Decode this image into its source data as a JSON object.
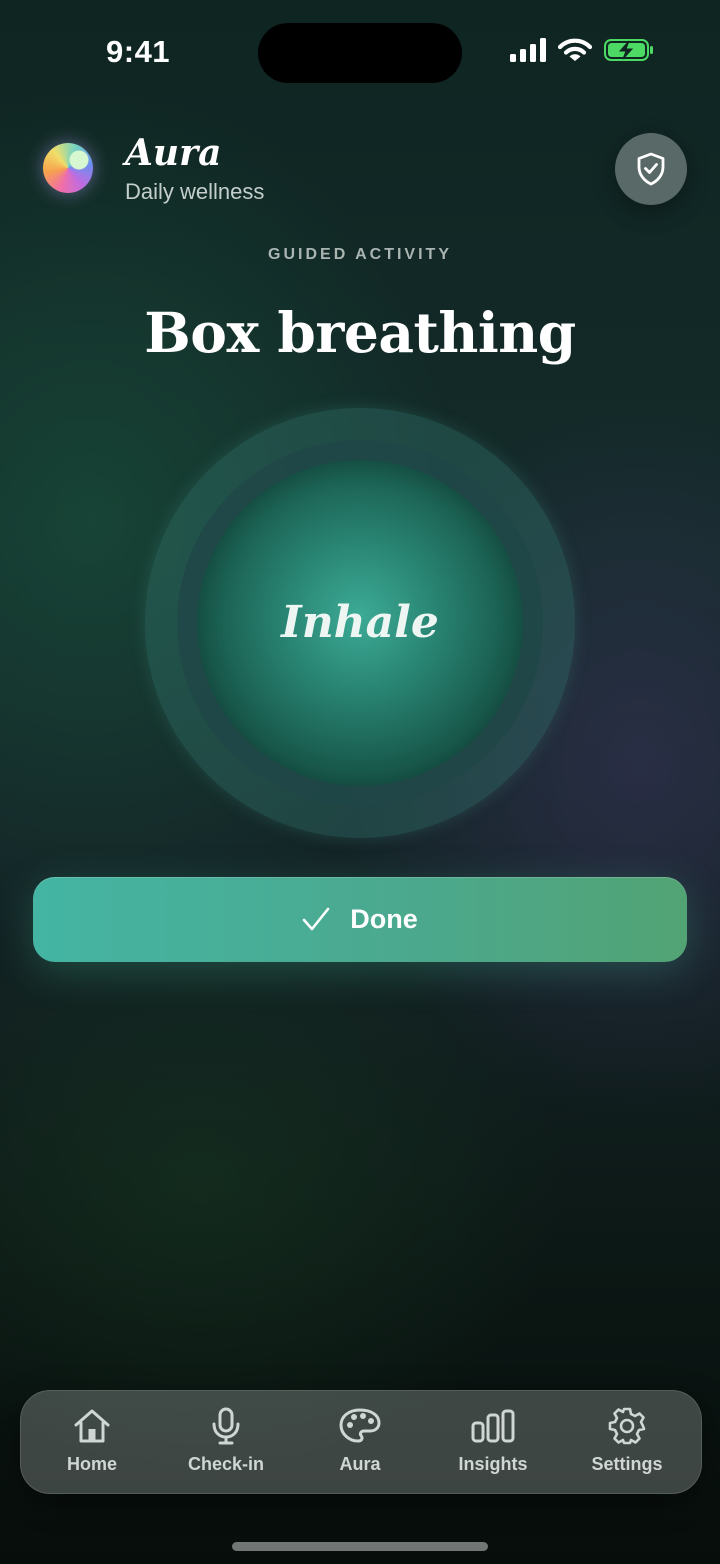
{
  "status_bar": {
    "time": "9:41"
  },
  "header": {
    "app_name": "Aura",
    "subtitle": "Daily wellness",
    "privacy_icon": "shield-check-icon"
  },
  "activity": {
    "eyebrow": "GUIDED ACTIVITY",
    "title": "Box breathing",
    "phase": "Inhale"
  },
  "done_button": {
    "icon": "checkmark-icon",
    "label": "Done"
  },
  "tabs": [
    {
      "label": "Home",
      "icon": "home-icon"
    },
    {
      "label": "Check-in",
      "icon": "microphone-icon"
    },
    {
      "label": "Aura",
      "icon": "palette-icon"
    },
    {
      "label": "Insights",
      "icon": "bar-chart-icon"
    },
    {
      "label": "Settings",
      "icon": "gear-icon"
    }
  ],
  "colors": {
    "accent_start": "#44b5a3",
    "accent_end": "#52a374",
    "orb": "#2a8775",
    "battery": "#4cd964"
  }
}
